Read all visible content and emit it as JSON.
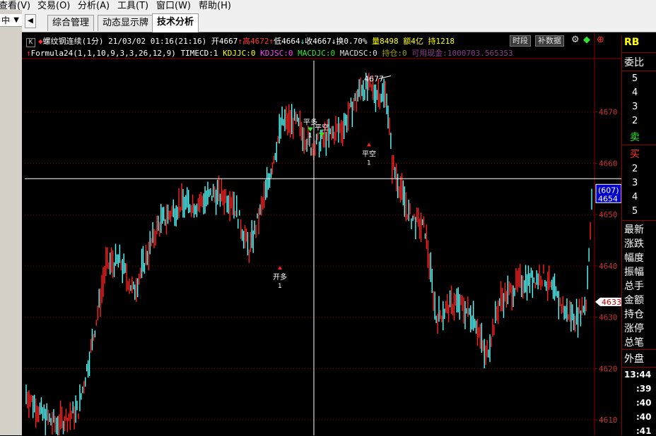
{
  "menu": [
    "查看(V)",
    "交易(O)",
    "分析(A)",
    "工具(T)",
    "窗口(W)",
    "帮助(H)"
  ],
  "left_panel": {
    "label": "中"
  },
  "tabs": [
    {
      "label": "综合管理",
      "active": false
    },
    {
      "label": "动态显示牌",
      "active": false
    },
    {
      "label": "技术分析",
      "active": true
    }
  ],
  "header": {
    "badge": "K",
    "instrument": "螺纹钢连续(1分)",
    "datetime": "21/03/02 01:16(21:16)",
    "open": "开4667",
    "high": "高4672",
    "low": "低4664",
    "close": "收4667",
    "turnover": "换0.70%",
    "volume": "量8498",
    "amount": "额4亿",
    "open_interest": "持1218",
    "btn_period": "时段",
    "btn_fill": "补数据"
  },
  "formula": {
    "name": "Formula24(1,1,10,9,3,3,26,12,9)",
    "timecd": "TIMECD:1",
    "kdjjc": "KDJJC:0",
    "kdjsc": "KDJSC:0",
    "macdjc": "MACDJC:0",
    "macdsc": "MACDSC:0",
    "position": "持仓:0",
    "available": "可用现金:1000703.565353"
  },
  "chart_data": {
    "type": "candlestick",
    "ylim": [
      4607,
      4680
    ],
    "yticks": [
      4610,
      4620,
      4630,
      4640,
      4650,
      4660,
      4670
    ],
    "crosshair_price": 4657,
    "crosshair_tag_top": "(607)",
    "crosshair_tag_bottom": "4654",
    "last_price_tag": "4633",
    "peak_label": "4677",
    "signals": [
      {
        "label": "开多",
        "count": "1",
        "price": 4640,
        "type": "buy"
      },
      {
        "label": "平多",
        "count": "1",
        "price": 4667,
        "type": "sell-green"
      },
      {
        "label": "平空",
        "count": "",
        "price": 4666,
        "type": "sell-green"
      },
      {
        "label": "平空",
        "count": "1",
        "price": 4664,
        "type": "buy"
      }
    ]
  },
  "right_panel": {
    "title": "RB",
    "order_book_label": "委比",
    "sell_levels": [
      "5",
      "4",
      "3",
      "2"
    ],
    "sell_label": "卖",
    "buy_label": "买",
    "buy_levels": [
      "2",
      "3",
      "4",
      "5"
    ],
    "stats": [
      "最新",
      "涨跌",
      "幅度",
      "振幅",
      "总手",
      "金额",
      "持仓",
      "涨停",
      "总笔",
      "外盘"
    ],
    "time": "13:44",
    "ticks": [
      ":39",
      ":40",
      ":40",
      ":41"
    ]
  },
  "colors": {
    "up": "#ff2020",
    "down": "#54ffff",
    "grid": "#8b0000",
    "axis_text": "#c83232"
  }
}
